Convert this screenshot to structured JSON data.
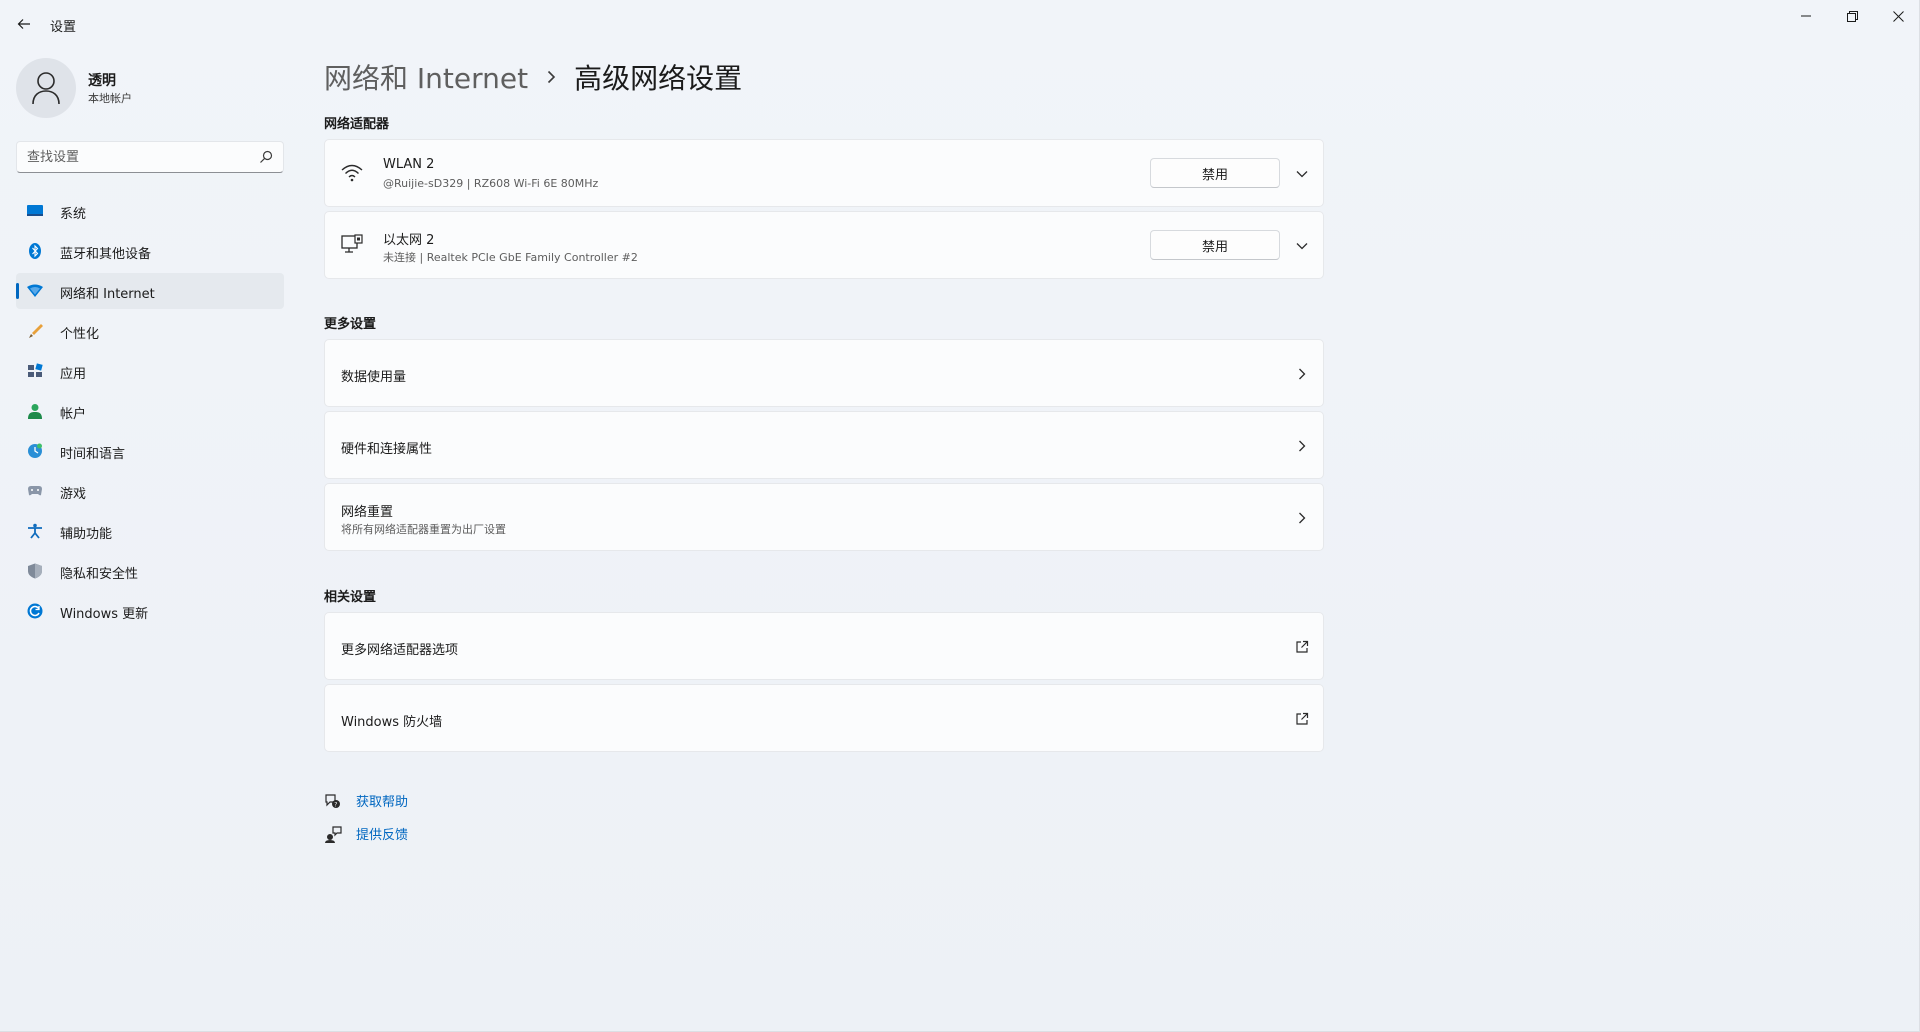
{
  "window": {
    "app_title": "设置",
    "controls": [
      "minimize-icon",
      "restore-icon",
      "close-icon"
    ]
  },
  "profile": {
    "name": "透明",
    "account_type": "本地帐户"
  },
  "search": {
    "placeholder": "查找设置"
  },
  "sidebar": {
    "items": [
      {
        "label": "系统",
        "icon": "system-icon",
        "active": false
      },
      {
        "label": "蓝牙和其他设备",
        "icon": "bluetooth-icon",
        "active": false
      },
      {
        "label": "网络和 Internet",
        "icon": "network-icon",
        "active": true
      },
      {
        "label": "个性化",
        "icon": "personalization-icon",
        "active": false
      },
      {
        "label": "应用",
        "icon": "apps-icon",
        "active": false
      },
      {
        "label": "帐户",
        "icon": "accounts-icon",
        "active": false
      },
      {
        "label": "时间和语言",
        "icon": "time-language-icon",
        "active": false
      },
      {
        "label": "游戏",
        "icon": "gaming-icon",
        "active": false
      },
      {
        "label": "辅助功能",
        "icon": "accessibility-icon",
        "active": false
      },
      {
        "label": "隐私和安全性",
        "icon": "privacy-icon",
        "active": false
      },
      {
        "label": "Windows 更新",
        "icon": "windows-update-icon",
        "active": false
      }
    ]
  },
  "breadcrumb": {
    "parent": "网络和 Internet",
    "current": "高级网络设置"
  },
  "adapters": {
    "section_title": "网络适配器",
    "items": [
      {
        "name": "WLAN 2",
        "description": "@Ruijie-sD329 | RZ608 Wi-Fi 6E 80MHz",
        "button": "禁用",
        "icon": "wifi-icon"
      },
      {
        "name": "以太网 2",
        "description": "未连接 | Realtek PCIe GbE Family Controller #2",
        "button": "禁用",
        "icon": "ethernet-icon"
      }
    ]
  },
  "more_settings": {
    "section_title": "更多设置",
    "items": [
      {
        "title": "数据使用量",
        "subtitle": ""
      },
      {
        "title": "硬件和连接属性",
        "subtitle": ""
      },
      {
        "title": "网络重置",
        "subtitle": "将所有网络适配器重置为出厂设置"
      }
    ]
  },
  "related_settings": {
    "section_title": "相关设置",
    "items": [
      {
        "title": "更多网络适配器选项"
      },
      {
        "title": "Windows 防火墙"
      }
    ]
  },
  "help": {
    "get_help": "获取帮助",
    "feedback": "提供反馈"
  },
  "colors": {
    "accent": "#0067c0",
    "background": "#eef2f7",
    "card": "#fbfcfd"
  }
}
